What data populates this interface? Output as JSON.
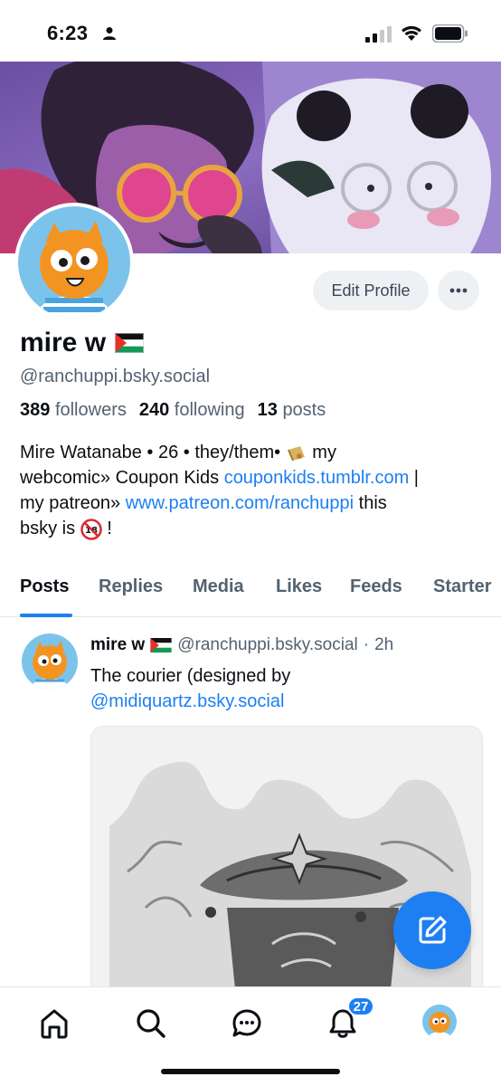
{
  "status_bar": {
    "time": "6:23"
  },
  "profile": {
    "display_name": "mire w",
    "handle": "@ranchuppi.bsky.social",
    "edit_profile_label": "Edit Profile",
    "followers_count": "389",
    "followers_label": "followers",
    "following_count": "240",
    "following_label": "following",
    "posts_count": "13",
    "posts_label": "posts",
    "bio": {
      "line1": "Mire Watanabe • 26 • they/them• ",
      "line1_after": " my",
      "line2_pre": "webcomic» Coupon Kids ",
      "link1": "couponkids.tumblr.com",
      "line2_post": " |",
      "line3_pre": "my patreon» ",
      "link2": "www.patreon.com/ranchuppi",
      "line3_post": " this",
      "line4_pre": "bsky is ",
      "line4_post": " !"
    }
  },
  "tabs": [
    {
      "label": "Posts",
      "active": true
    },
    {
      "label": "Replies"
    },
    {
      "label": "Media"
    },
    {
      "label": "Likes"
    },
    {
      "label": "Feeds"
    },
    {
      "label": "Starter"
    }
  ],
  "post": {
    "author": "mire w",
    "handle": "@ranchuppi.bsky.social",
    "separator": "·",
    "time": "2h",
    "text_line1": "The courier (designed by",
    "mention": "@midiquartz.bsky.social"
  },
  "bottom_nav": {
    "notifications_badge": "27"
  },
  "icons": {
    "home": "home-icon",
    "search": "search-icon",
    "chat": "chat-icon",
    "notifications": "bell-icon",
    "compose": "compose-icon"
  },
  "colors": {
    "accent": "#1d7ff2",
    "muted_text": "#536271"
  }
}
